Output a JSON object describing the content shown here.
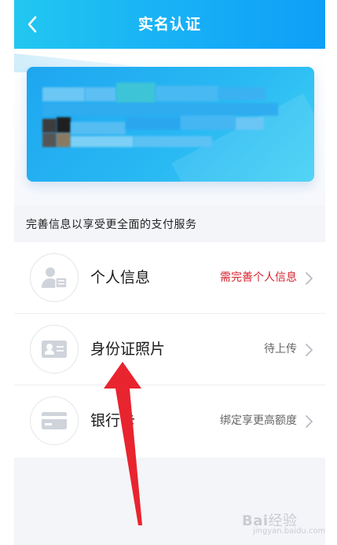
{
  "header": {
    "title": "实名认证",
    "back_icon": "chevron-left-icon"
  },
  "card": {
    "pixelated": true,
    "colors": {
      "start": "#1ea6f0",
      "end": "#3fd0f4"
    }
  },
  "section_caption": "完善信息以享受更全面的支付服务",
  "items": [
    {
      "label": "个人信息",
      "status": "需完善个人信息",
      "status_color": "#d6242f",
      "icon": "person-info-icon"
    },
    {
      "label": "身份证照片",
      "status": "待上传",
      "status_color": "#666666",
      "icon": "id-card-icon"
    },
    {
      "label": "银行卡",
      "status": "绑定享更高额度",
      "status_color": "#666666",
      "icon": "bank-card-icon"
    }
  ],
  "annotation": {
    "type": "red-arrow",
    "color": "#e8242f",
    "points_to": "身份证照片"
  },
  "watermark": {
    "text": "Bai经验",
    "sub": "jingyan.baidu.com"
  },
  "colors": {
    "header": "#19b3f5",
    "page_bg": "#f4f5f9",
    "warn": "#d6242f"
  }
}
